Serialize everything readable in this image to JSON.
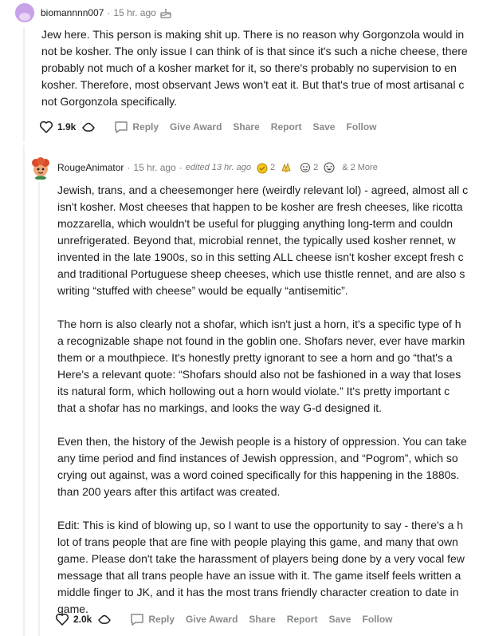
{
  "comment1": {
    "username": "biomannnn007",
    "time": "15 hr. ago",
    "body_lines": [
      "Jew here. This person is making shit up. There is no reason why Gorgonzola would in",
      "not be kosher. The only issue I can think of is that since it's such a niche cheese, there",
      "probably not much of a kosher market for it, so there's probably no supervision to en",
      "kosher. Therefore, most observant Jews won't eat it. But that's true of most artisanal c",
      "not Gorgonzola specifically."
    ],
    "votes": "1.9k",
    "actions": [
      "Reply",
      "Give Award",
      "Share",
      "Report",
      "Save",
      "Follow"
    ]
  },
  "comment2": {
    "username": "RougeAnimator",
    "time": "15 hr. ago",
    "edited": "edited 13 hr. ago",
    "awards": [
      {
        "icon": "gold-award-icon",
        "count": "2"
      },
      {
        "icon": "helpful-award-icon",
        "count": ""
      },
      {
        "icon": "wholesome-award-icon",
        "count": "2"
      },
      {
        "icon": "laughing-award-icon",
        "count": ""
      }
    ],
    "more_awards": "& 2 More",
    "paragraphs": [
      [
        "Jewish, trans, and a cheesemonger here (weirdly relevant lol) - agreed, almost all c",
        "isn't kosher. Most cheeses that happen to be kosher are fresh cheeses, like ricotta",
        "mozzarella, which wouldn't be useful for plugging anything long-term and couldn",
        "unrefrigerated. Beyond that, microbial rennet, the typically used kosher rennet, w",
        "invented in the late 1900s, so in this setting ALL cheese isn't kosher except fresh c",
        "and traditional Portuguese sheep cheeses, which use thistle rennet, and are also s",
        "writing “stuffed with cheese” would be equally “antisemitic”."
      ],
      [
        "The horn is also clearly not a shofar, which isn't just a horn, it's a specific type of h",
        "a recognizable shape not found in the goblin one. Shofars never, ever have markin",
        "them or a mouthpiece. It's honestly pretty ignorant to see a horn and go “that's a",
        "Here's a relevant quote: “Shofars should also not be fashioned in a way that loses",
        "its natural form, which hollowing out a horn would violate.” It's pretty important c",
        "that a shofar has no markings, and looks the way G-d designed it."
      ],
      [
        "Even then, the history of the Jewish people is a history of oppression. You can take",
        "any time period and find instances of Jewish oppression, and “Pogrom”, which so",
        "crying out against, was a word coined specifically for this happening in the 1880s.",
        "than 200 years after this artifact was created."
      ],
      [
        "Edit: This is kind of blowing up, so I want to use the opportunity to say - there's a h",
        "lot of trans people that are fine with people playing this game, and many that own",
        "game. Please don't take the harassment of players being done by a very vocal few",
        "message that all trans people have an issue with it. The game itself feels written a",
        "middle finger to JK, and it has the most trans friendly character creation to date in",
        "game."
      ]
    ],
    "votes": "2.0k",
    "actions": [
      "Reply",
      "Give Award",
      "Share",
      "Report",
      "Save",
      "Follow"
    ]
  },
  "colors": {
    "text": "#1c1c1c",
    "meta": "#7c7c7c",
    "action": "#878a8c",
    "thread_line": "#edeff1",
    "avatar1": "#c8a2e8"
  }
}
